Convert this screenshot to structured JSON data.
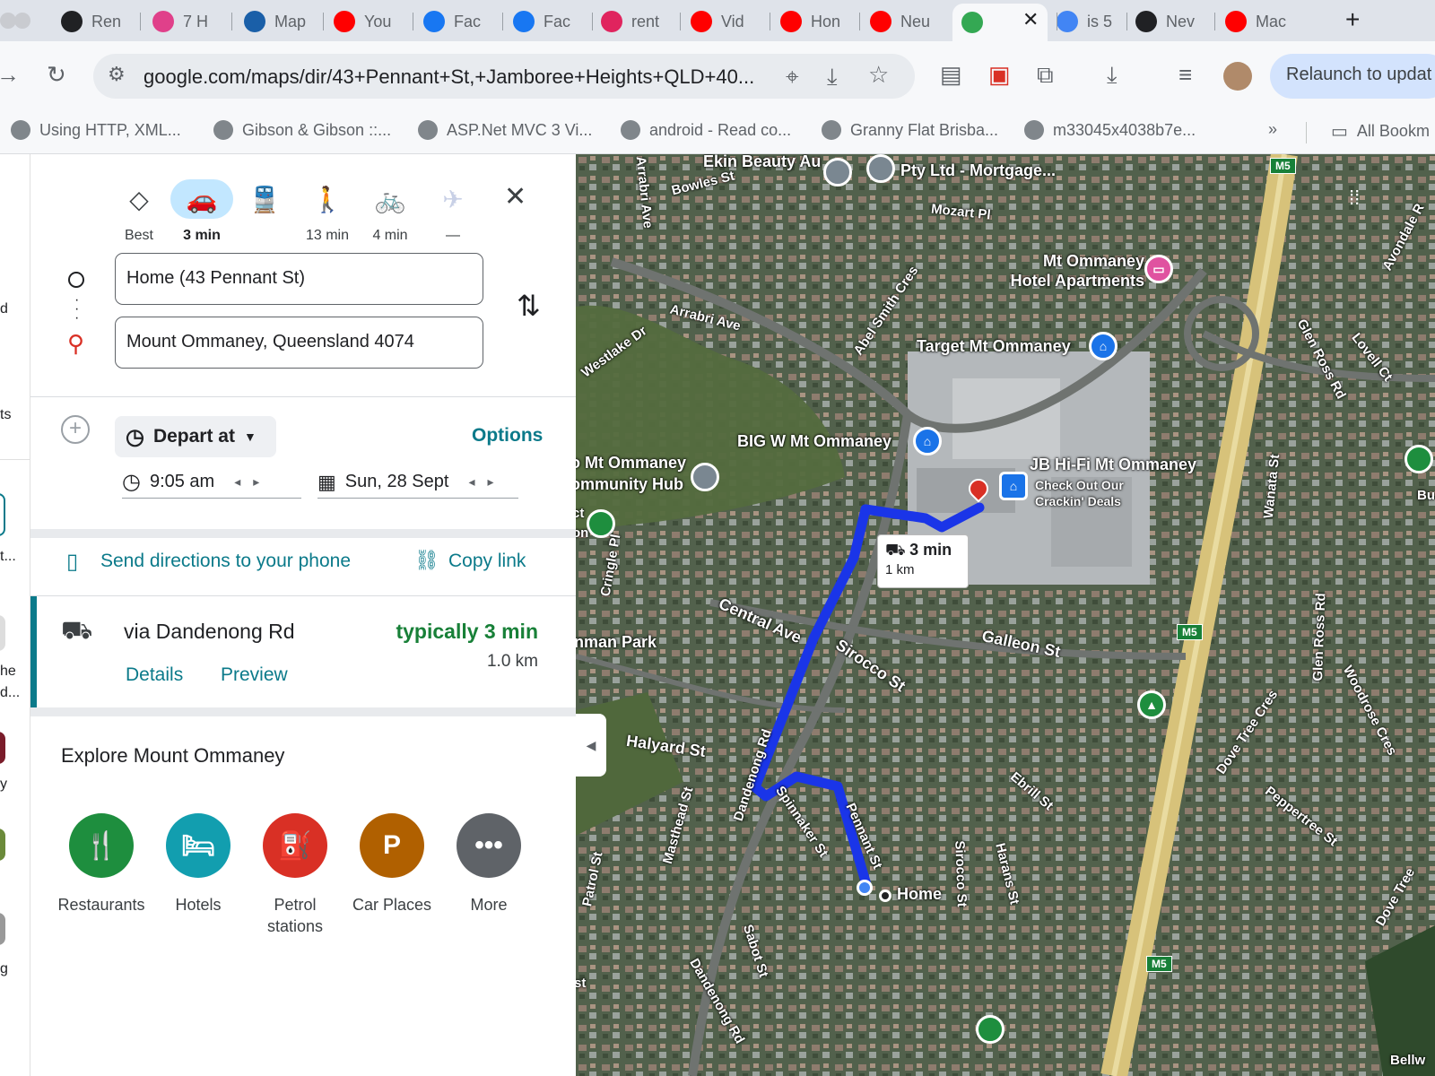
{
  "browser": {
    "tabs": [
      {
        "label": "Ren",
        "icon": "openai-icon",
        "color": "#202124"
      },
      {
        "label": "7 H",
        "icon": "inbox-icon",
        "color": "#e0408a"
      },
      {
        "label": "Map",
        "icon": "map-icon",
        "color": "#1a5fa8"
      },
      {
        "label": "You",
        "icon": "youtube-icon",
        "color": "#ff0000"
      },
      {
        "label": "Fac",
        "icon": "facebook-icon",
        "color": "#1877f2"
      },
      {
        "label": "Fac",
        "icon": "facebook-icon",
        "color": "#1877f2"
      },
      {
        "label": "rent",
        "icon": "home-icon",
        "color": "#e0245e"
      },
      {
        "label": "Vid",
        "icon": "youtube-icon",
        "color": "#ff0000"
      },
      {
        "label": "Hon",
        "icon": "youtube-icon",
        "color": "#ff0000"
      },
      {
        "label": "Neu",
        "icon": "youtube-icon",
        "color": "#ff0000"
      },
      {
        "label": "",
        "icon": "google-maps-icon",
        "color": "#34a853"
      },
      {
        "label": "is 5",
        "icon": "google-icon",
        "color": "#4285f4"
      },
      {
        "label": "Nev",
        "icon": "openai-icon",
        "color": "#202124"
      },
      {
        "label": "Mac",
        "icon": "youtube-icon",
        "color": "#ff0000"
      }
    ],
    "close_tab_glyph": "✕",
    "new_tab_glyph": "+",
    "url": "google.com/maps/dir/43+Pennant+St,+Jamboree+Heights+QLD+40...",
    "relaunch_label": "Relaunch to updat",
    "bookmarks": [
      "Using HTTP, XML...",
      "Gibson & Gibson ::...",
      "ASP.Net MVC 3 Vi...",
      "android - Read co...",
      "Granny Flat Brisba...",
      "m33045x4038b7e..."
    ],
    "bookmarks_overflow": "»",
    "all_bookmarks": "All Bookm"
  },
  "left_rail": {
    "fragments": [
      "d",
      "ts",
      "t...",
      "he",
      "d...",
      "y",
      "g"
    ]
  },
  "directions": {
    "modes": [
      {
        "name": "best",
        "label": "Best",
        "glyph": "◇"
      },
      {
        "name": "driving",
        "label": "3 min",
        "glyph": "🚗"
      },
      {
        "name": "transit",
        "label": "",
        "glyph": "🚆"
      },
      {
        "name": "walking",
        "label": "13 min",
        "glyph": "🚶"
      },
      {
        "name": "cycling",
        "label": "4 min",
        "glyph": "🚲"
      },
      {
        "name": "flight",
        "label": "—",
        "glyph": "✈"
      }
    ],
    "selected_mode": "driving",
    "close_glyph": "✕",
    "origin": "Home (43 Pennant St)",
    "destination": "Mount Ommaney, Queensland 4074",
    "swap_glyph": "⇅",
    "depart_label": "Depart at",
    "options_label": "Options",
    "time": "9:05 am",
    "date": "Sun, 28 Sept",
    "send_label": "Send directions to your phone",
    "copy_link_label": "Copy link",
    "route": {
      "via": "via Dandenong Rd",
      "duration": "typically 3 min",
      "distance": "1.0 km",
      "details_label": "Details",
      "preview_label": "Preview"
    },
    "explore_title": "Explore Mount Ommaney",
    "categories": [
      {
        "label": "Restaurants",
        "glyph": "🍴",
        "color": "#1e8e3e"
      },
      {
        "label": "Hotels",
        "glyph": "🛏",
        "color": "#129eaf"
      },
      {
        "label": "Petrol stations",
        "glyph": "⛽",
        "color": "#d93025"
      },
      {
        "label": "Car Places",
        "glyph": "P",
        "color": "#b06000"
      },
      {
        "label": "More",
        "glyph": "•••",
        "color": "#5f6368"
      }
    ]
  },
  "map": {
    "labels": {
      "ekin": "Ekin Beauty Au",
      "pty": "Pty Ltd - Mortgage...",
      "bowles": "Bowles St",
      "arrabri_ave_top": "Arrabri Ave",
      "mozart": "Mozart Pl",
      "hotel": "Mt Ommaney Hotel Apartments",
      "westlake": "Westlake Dr",
      "arrabri": "Arrabri Ave",
      "abel": "Abel Smith Cres",
      "target": "Target Mt Ommaney",
      "glen_ross_top": "Glen Ross Rd",
      "lovell": "Lovell Ct",
      "avondale": "Avondale R",
      "bigw": "BIG W Mt Ommaney",
      "community": "o Mt Ommaney ommunity Hub",
      "jbhifi": "JB Hi-Fi Mt Ommaney",
      "jbhifi_sub": "Check Out Our Crackin' Deals",
      "wanata": "Wanata St",
      "cringle": "Cringle Pl",
      "central": "Central Ave",
      "park": "nman Park",
      "sirocco_a": "Sirocco St",
      "galleon": "Galleon St",
      "glen_ross": "Glen Ross Rd",
      "halyard": "Halyard St",
      "dandenong": "Dandenong Rd",
      "spinnaker": "Spinnaker St",
      "pennant": "Pennant St",
      "masthead": "Masthead St",
      "dove_tree": "Dove Tree Cres",
      "woodrose": "Woodrose Cres",
      "ebrill": "Ebrill St",
      "peppertree": "Peppertree St",
      "patrol": "Patrol St",
      "home": "Home",
      "sirocco_b": "Sirocco St",
      "harans": "Harans St",
      "sabot": "Sabot St",
      "dandenong_b": "Dandenong Rd",
      "dove_tree_b": "Dove Tree",
      "bellw": "Bellw",
      "st": "st",
      "ct_on": "ct on",
      "bu": "Bu",
      "m5": "M5"
    },
    "route_card": {
      "time": "3 min",
      "distance": "1 km"
    },
    "route_color": "#1a35e8",
    "destination_pin_color": "#d93025",
    "collapse_glyph": "◀"
  }
}
